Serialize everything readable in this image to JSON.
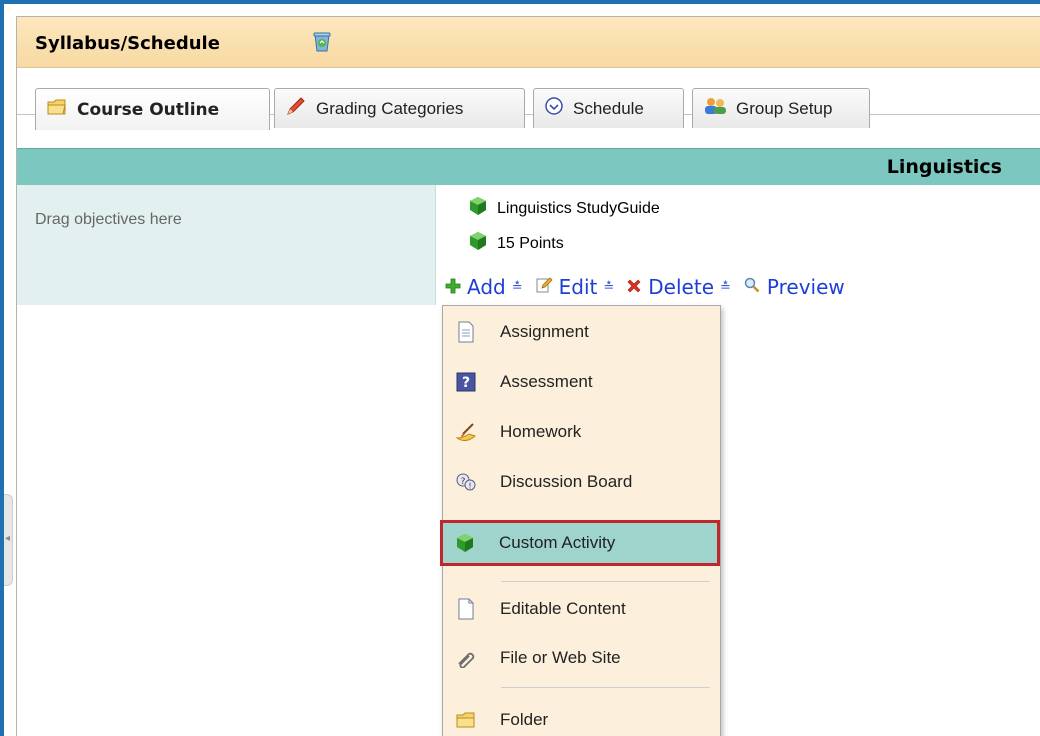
{
  "window": {
    "title": "Syllabus/Schedule"
  },
  "tabs": [
    {
      "label": "Course Outline",
      "icon": "folder-icon",
      "active": true
    },
    {
      "label": "Grading Categories",
      "icon": "pencil-icon",
      "active": false
    },
    {
      "label": "Schedule",
      "icon": "clock-icon",
      "active": false
    },
    {
      "label": "Group Setup",
      "icon": "group-icon",
      "active": false
    }
  ],
  "course": {
    "title": "Linguistics"
  },
  "dropzone": {
    "text": "Drag objectives here"
  },
  "activities": [
    {
      "label": "Linguistics StudyGuide",
      "icon": "green-cube-icon"
    },
    {
      "label": "15 Points",
      "icon": "green-cube-icon"
    }
  ],
  "toolbar": {
    "add": "Add",
    "edit": "Edit",
    "delete": "Delete",
    "preview": "Preview"
  },
  "menu": {
    "items": [
      {
        "label": "Assignment",
        "icon": "document-icon"
      },
      {
        "label": "Assessment",
        "icon": "question-icon"
      },
      {
        "label": "Homework",
        "icon": "homework-icon"
      },
      {
        "label": "Discussion Board",
        "icon": "discussion-icon"
      },
      {
        "label": "Custom Activity",
        "icon": "green-cube-icon",
        "selected": true
      },
      {
        "label": "Editable Content",
        "icon": "blank-page-icon"
      },
      {
        "label": "File or Web Site",
        "icon": "paperclip-icon"
      },
      {
        "label": "Folder",
        "icon": "folder-icon"
      }
    ]
  },
  "colors": {
    "accent": "#1f6fb3",
    "course_bar": "#7cc7c0",
    "menu_bg": "#fcf0dc",
    "selected_bg": "#9fd4cd",
    "highlight_border": "#c0272d",
    "link": "#1e3fd6"
  }
}
